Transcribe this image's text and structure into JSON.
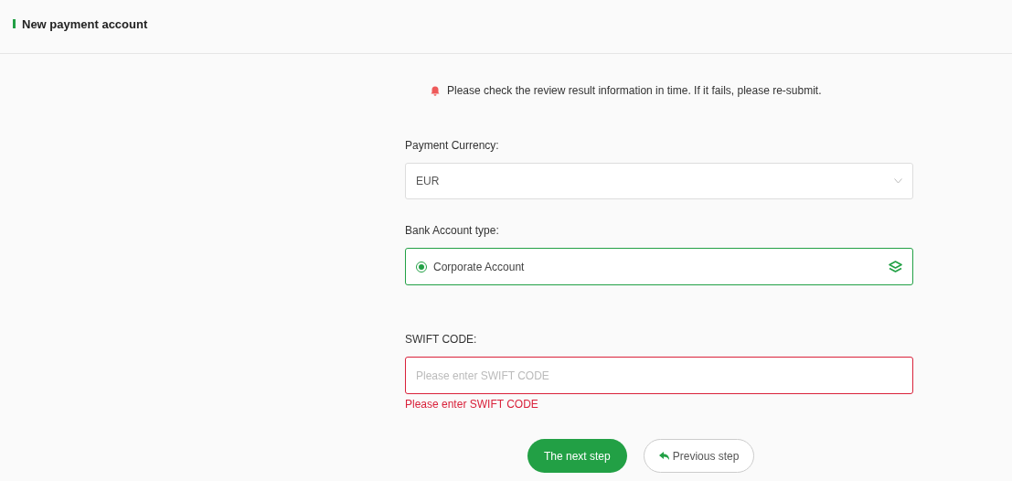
{
  "header": {
    "title": "New payment account"
  },
  "notice": {
    "text": "Please check the review result information in time. If it fails, please re-submit."
  },
  "currency": {
    "label": "Payment Currency:",
    "value": "EUR"
  },
  "account_type": {
    "label": "Bank Account type:",
    "option": {
      "label": "Corporate Account",
      "selected": true
    }
  },
  "swift": {
    "label": "SWIFT CODE:",
    "placeholder": "Please enter SWIFT CODE",
    "error": "Please enter SWIFT CODE"
  },
  "buttons": [
    {
      "kind": "primary",
      "label": "The next step"
    },
    {
      "kind": "back",
      "label": "Previous step"
    }
  ]
}
